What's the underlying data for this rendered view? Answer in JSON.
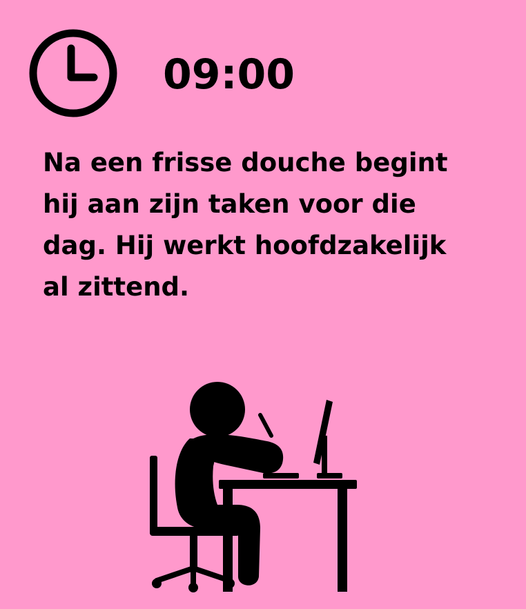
{
  "header": {
    "time": "09:00",
    "clock_icon": "clock-icon"
  },
  "description": {
    "lines": [
      "Na een frisse douche begint",
      "hij aan zijn taken voor die",
      "dag. Hij werkt hoofdzakelijk",
      "al zittend."
    ]
  },
  "illustration": {
    "icon": "person-working-at-desk-icon"
  },
  "colors": {
    "background": "#FF99CC",
    "foreground": "#000000"
  }
}
